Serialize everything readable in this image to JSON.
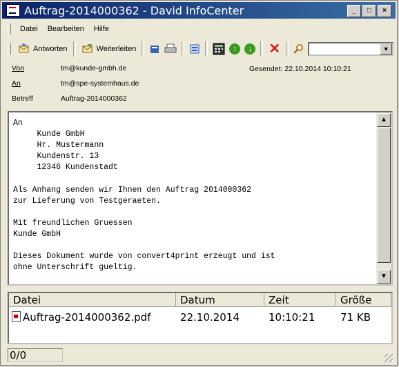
{
  "window": {
    "title": "Auftrag-2014000362 - David InfoCenter"
  },
  "menu": [
    {
      "label": "Datei"
    },
    {
      "label": "Bearbeiten"
    },
    {
      "label": "Hilfe"
    }
  ],
  "toolbar": {
    "reply_label": "Antworten",
    "forward_label": "Weiterleiten",
    "search_value": ""
  },
  "header": {
    "from_label": "Von",
    "from_value": "tm@kunde-gmbh.de",
    "to_label": "An",
    "to_value": "tm@spe-systemhaus.de",
    "subject_label": "Betreff",
    "subject_value": "Auftrag-2014000362",
    "sent_label": "Gesendet:",
    "sent_value": "22.10.2014 10:10:21"
  },
  "body": {
    "text": "An\n     Kunde GmbH\n     Hr. Mustermann\n     Kundenstr. 13\n     12346 Kundenstadt\n\nAls Anhang senden wir Ihnen den Auftrag 2014000362\nzur Lieferung von Testgeraeten.\n\nMit freundlichen Gruessen\nKunde GmbH\n\nDieses Dokument wurde von convert4print erzeugt und ist\nohne Unterschrift gueltig."
  },
  "attachments": {
    "columns": [
      "Datei",
      "Datum",
      "Zeit",
      "Größe"
    ],
    "rows": [
      {
        "file": "Auftrag-2014000362.pdf",
        "date": "22.10.2014",
        "time": "10:10:21",
        "size": "71 KB"
      }
    ]
  },
  "status": {
    "text": "0/0"
  }
}
